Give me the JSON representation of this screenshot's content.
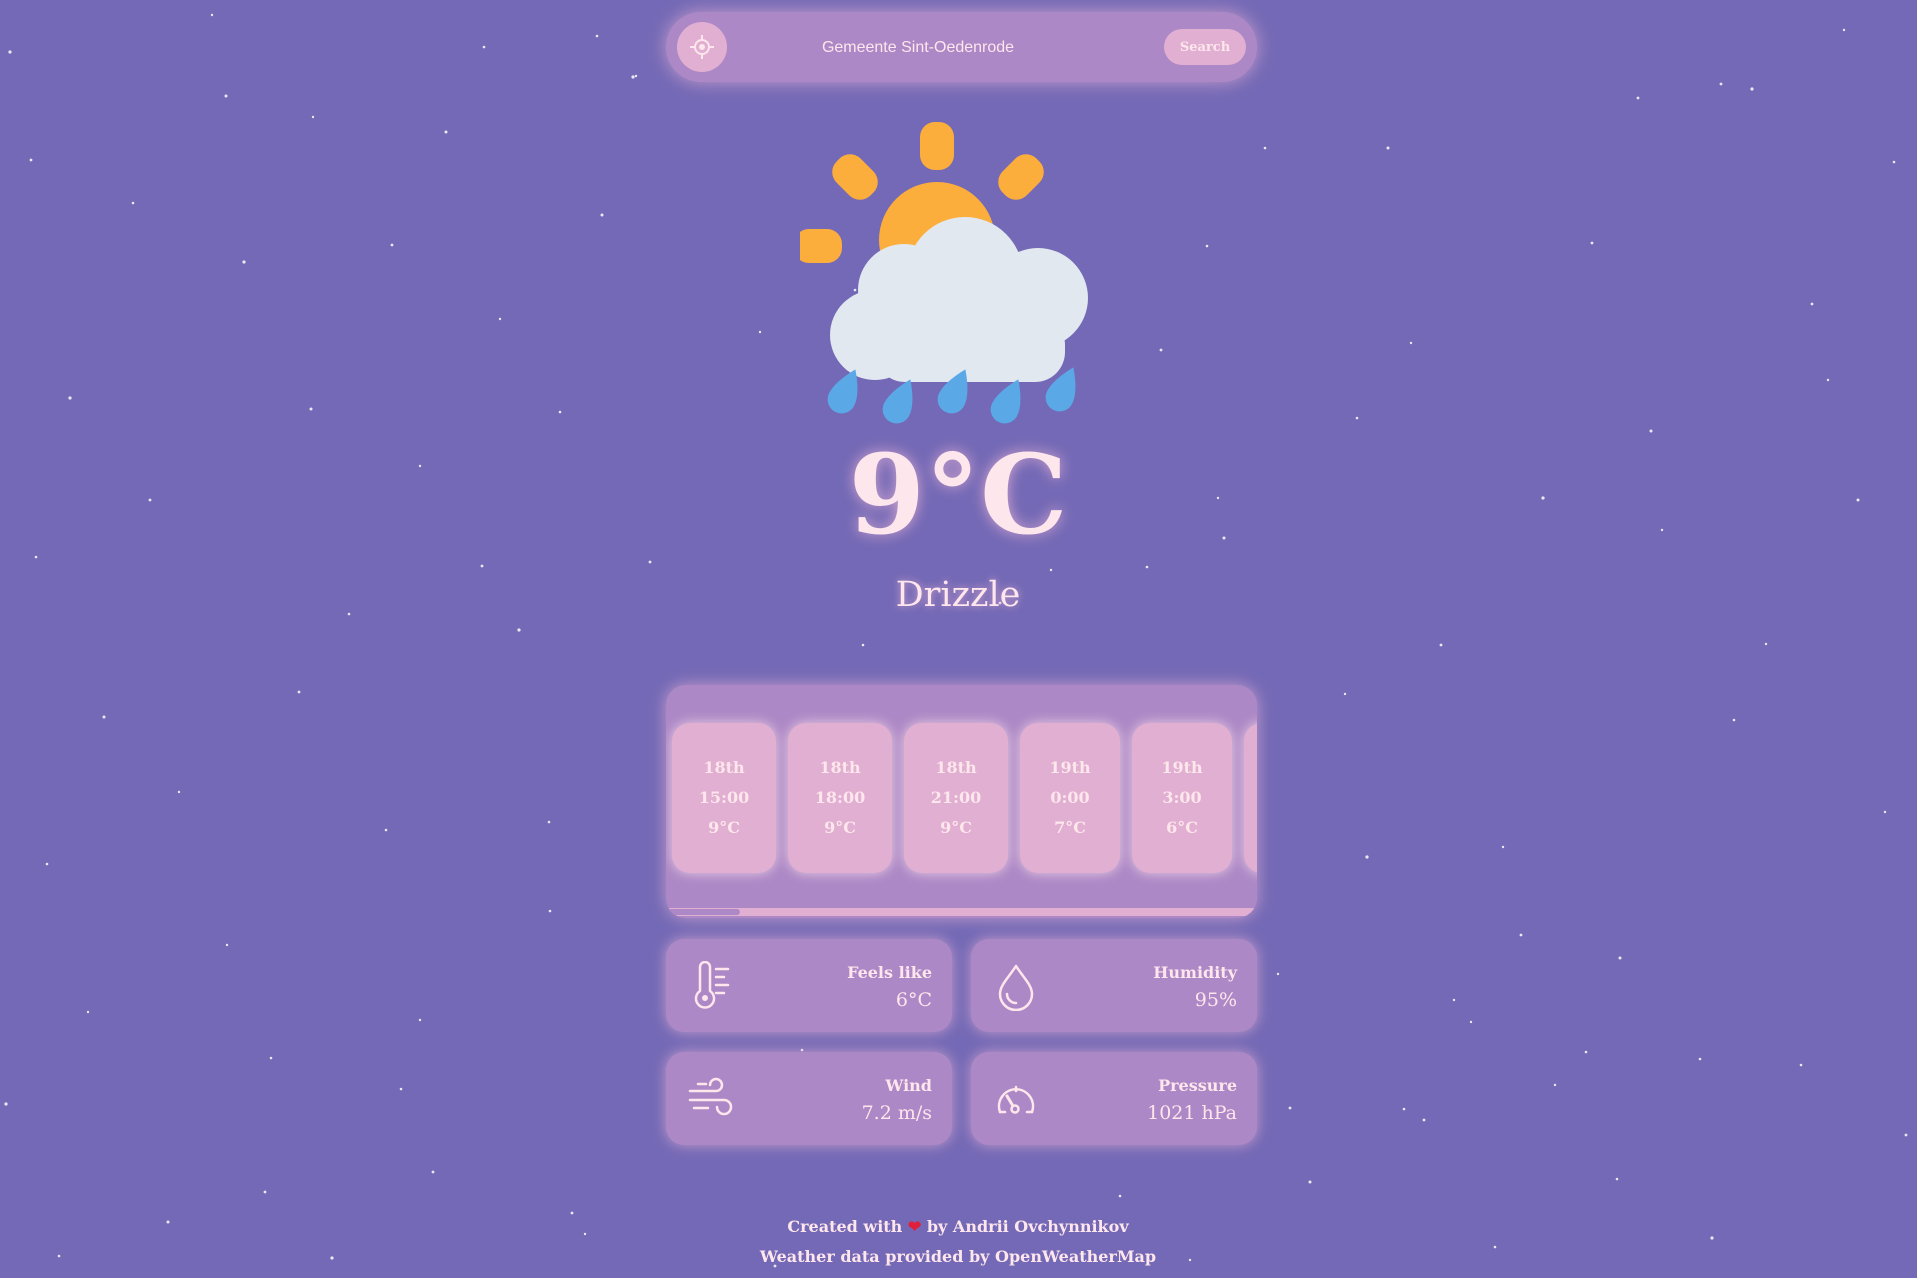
{
  "search": {
    "location_value": "Gemeente Sint-Oedenrode",
    "button_label": "Search"
  },
  "current": {
    "temperature": "9°C",
    "condition": "Drizzle",
    "icon": "sun-cloud-rain-icon"
  },
  "forecast": [
    {
      "day": "18th",
      "time": "15:00",
      "temp": "9°C"
    },
    {
      "day": "18th",
      "time": "18:00",
      "temp": "9°C"
    },
    {
      "day": "18th",
      "time": "21:00",
      "temp": "9°C"
    },
    {
      "day": "19th",
      "time": "0:00",
      "temp": "7°C"
    },
    {
      "day": "19th",
      "time": "3:00",
      "temp": "6°C"
    }
  ],
  "details": {
    "feels_like": {
      "label": "Feels like",
      "value": "6°C",
      "icon": "thermometer-icon"
    },
    "humidity": {
      "label": "Humidity",
      "value": "95%",
      "icon": "water-drop-icon"
    },
    "wind": {
      "label": "Wind",
      "value": "7.2 m/s",
      "icon": "wind-icon"
    },
    "pressure": {
      "label": "Pressure",
      "value": "1021 hPa",
      "icon": "gauge-icon"
    }
  },
  "footer": {
    "credit_prefix": "Created with",
    "credit_heart": "❤",
    "credit_suffix": "by Andrii Ovchynnikov",
    "data_source": "Weather data provided by OpenWeatherMap"
  },
  "colors": {
    "background": "#7469b6",
    "panel": "#ad88c6",
    "card": "#e1afd1",
    "text": "#fde6ec",
    "sun": "#fbae3c",
    "cloud": "#e2e8f0",
    "rain": "#5aa9e6"
  }
}
